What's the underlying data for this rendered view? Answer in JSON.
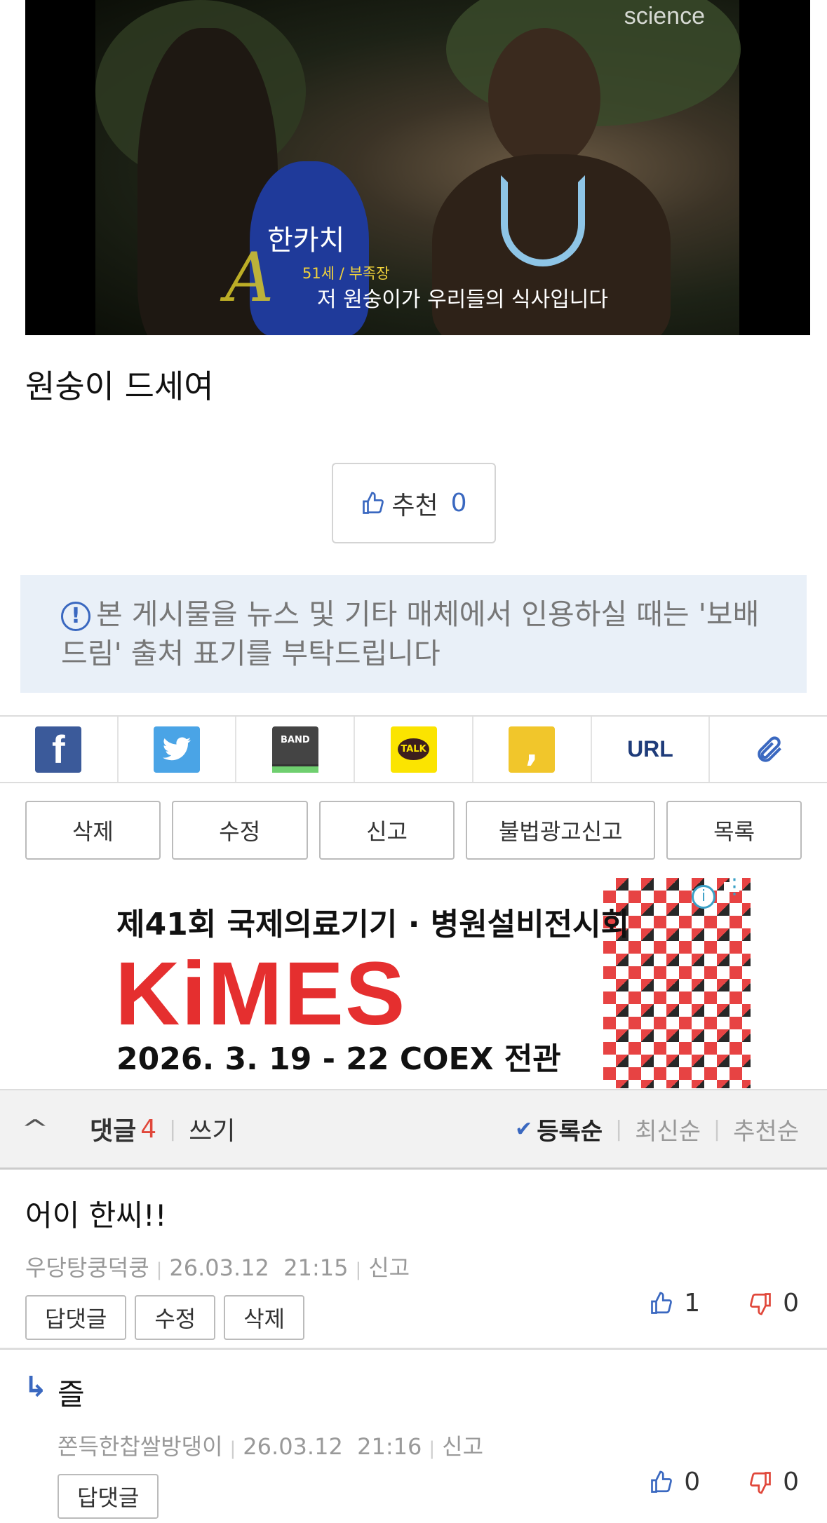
{
  "video": {
    "watermark": "science",
    "caption_name": "한카치",
    "caption_age": "51세 / 부족장",
    "caption_subtitle": "저 원숭이가 우리들의 식사입니다"
  },
  "post": {
    "text": "원숭이 드세여"
  },
  "recommend": {
    "label": "추천",
    "count": "0"
  },
  "notice": {
    "text": "본 게시물을 뉴스 및 기타 매체에서 인용하실 때는 '보배드림' 출처 표기를 부탁드립니다"
  },
  "share": {
    "icons": [
      "facebook-icon",
      "twitter-icon",
      "band-icon",
      "kakaotalk-icon",
      "kakaostory-icon",
      "url",
      "clip-icon"
    ],
    "band_label": "BAND",
    "talk_label": "TALK",
    "url_label": "URL"
  },
  "actions": {
    "delete": "삭제",
    "edit": "수정",
    "report": "신고",
    "illegal_ad_report": "불법광고신고",
    "list": "목록"
  },
  "ad": {
    "headline": "제41회 국제의료기기 · 병원설비전시회",
    "brand": "KiMES",
    "date": "2026. 3. 19 - 22  COEX 전관"
  },
  "comments_bar": {
    "label": "댓글",
    "count": "4",
    "write": "쓰기",
    "sort_registered": "등록순",
    "sort_newest": "최신순",
    "sort_recommended": "추천순"
  },
  "comments": [
    {
      "text": "어이 한씨!!",
      "author": "우당탕쿵덕쿵",
      "date": "26.03.12",
      "time": "21:15",
      "report": "신고",
      "buttons": [
        "답댓글",
        "수정",
        "삭제"
      ],
      "up": "1",
      "down": "0"
    },
    {
      "text": "즐",
      "author": "쫀득한찹쌀방댕이",
      "date": "26.03.12",
      "time": "21:16",
      "report": "신고",
      "buttons": [
        "답댓글"
      ],
      "up": "0",
      "down": "0"
    }
  ],
  "colors": {
    "accent_blue": "#3a68c0",
    "red": "#e0473a",
    "notice_bg": "#e9f0f8"
  }
}
